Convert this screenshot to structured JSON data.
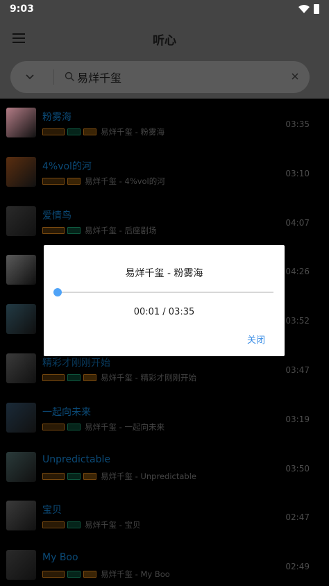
{
  "status_bar": {
    "time": "9:03"
  },
  "app_bar": {
    "title": "听心"
  },
  "search": {
    "value": "易烊千玺"
  },
  "songs": [
    {
      "title": "粉雾海",
      "meta": "易烊千玺 - 粉雾海",
      "duration": "03:35",
      "badges": [
        "q",
        "v",
        "o"
      ],
      "color": "#b37c86"
    },
    {
      "title": "4%vol的河",
      "meta": "易烊千玺 - 4%vol的河",
      "duration": "03:10",
      "badges": [
        "q",
        "o"
      ],
      "color": "#5a2e10"
    },
    {
      "title": "爱情鸟",
      "meta": "易烊千玺 - 后座剧场",
      "duration": "04:07",
      "badges": [
        "q",
        "v"
      ],
      "color": "#2a2a2a"
    },
    {
      "title": "",
      "meta": "",
      "duration": "04:26",
      "badges": [],
      "color": "#5a5a5a"
    },
    {
      "title": "",
      "meta": "",
      "duration": "03:52",
      "badges": [],
      "color": "#223a44"
    },
    {
      "title": "精彩才刚刚开始",
      "meta": "易烊千玺 - 精彩才刚刚开始",
      "duration": "03:47",
      "badges": [
        "q",
        "v",
        "o"
      ],
      "color": "#3a3a3a"
    },
    {
      "title": "一起向未来",
      "meta": "易烊千玺 - 一起向未来",
      "duration": "03:19",
      "badges": [
        "q",
        "v"
      ],
      "color": "#1a2a38"
    },
    {
      "title": "Unpredictable",
      "meta": "易烊千玺 - Unpredictable",
      "duration": "03:50",
      "badges": [
        "q",
        "v",
        "o"
      ],
      "color": "#2a3a3a"
    },
    {
      "title": "宝贝",
      "meta": "易烊千玺 - 宝贝",
      "duration": "02:47",
      "badges": [
        "q",
        "v"
      ],
      "color": "#3a3a3a"
    },
    {
      "title": "My Boo",
      "meta": "易烊千玺 - My Boo",
      "duration": "02:49",
      "badges": [
        "q",
        "v",
        "o"
      ],
      "color": "#2a2a2a"
    }
  ],
  "dialog": {
    "title": "易烊千玺 - 粉雾海",
    "time": "00:01 / 03:35",
    "progress": 0.005,
    "close_label": "关闭"
  }
}
